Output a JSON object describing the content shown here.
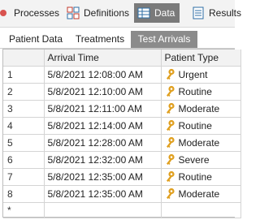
{
  "ribbon": {
    "tabs": [
      {
        "label": "Processes",
        "icon": "processes-icon",
        "active": false
      },
      {
        "label": "Definitions",
        "icon": "definitions-icon",
        "active": false
      },
      {
        "label": "Data",
        "icon": "data-icon",
        "active": true
      },
      {
        "label": "Results",
        "icon": "results-icon",
        "active": false
      }
    ]
  },
  "subtabs": [
    {
      "label": "Patient Data",
      "active": false
    },
    {
      "label": "Treatments",
      "active": false
    },
    {
      "label": "Test Arrivals",
      "active": true
    }
  ],
  "grid": {
    "columns": [
      "",
      "Arrival Time",
      "Patient Type"
    ],
    "rows": [
      {
        "index": "1",
        "arrival": "5/8/2021 12:08:00 AM",
        "type": "Urgent"
      },
      {
        "index": "2",
        "arrival": "5/8/2021 12:10:00 AM",
        "type": "Routine"
      },
      {
        "index": "3",
        "arrival": "5/8/2021 12:11:00 AM",
        "type": "Moderate"
      },
      {
        "index": "4",
        "arrival": "5/8/2021 12:14:00 AM",
        "type": "Routine"
      },
      {
        "index": "5",
        "arrival": "5/8/2021 12:28:00 AM",
        "type": "Moderate"
      },
      {
        "index": "6",
        "arrival": "5/8/2021 12:32:00 AM",
        "type": "Severe"
      },
      {
        "index": "7",
        "arrival": "5/8/2021 12:35:00 AM",
        "type": "Routine"
      },
      {
        "index": "8",
        "arrival": "5/8/2021 12:35:00 AM",
        "type": "Moderate"
      }
    ],
    "new_row_marker": "*"
  },
  "colors": {
    "key": "#e0a020",
    "active_tab": "#7a7a7a"
  }
}
